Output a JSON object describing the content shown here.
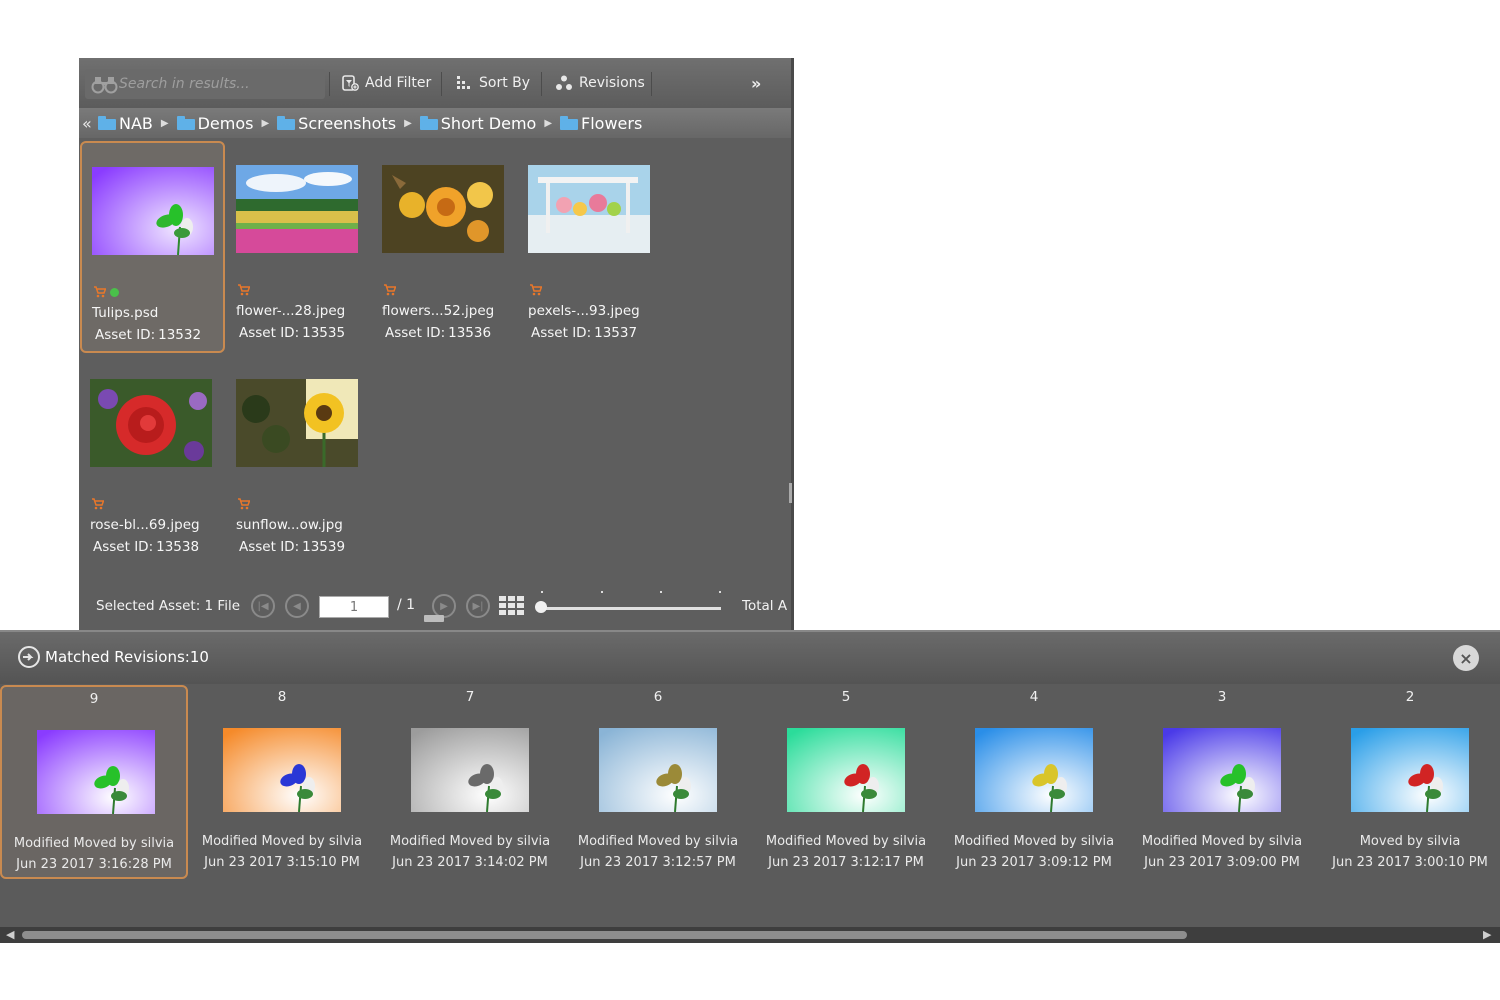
{
  "toolbar": {
    "search_placeholder": "Search in results...",
    "add_filter": "Add Filter",
    "sort_by": "Sort By",
    "revisions": "Revisions",
    "more": "»"
  },
  "breadcrumb": {
    "back": "«",
    "items": [
      "NAB",
      "Demos",
      "Screenshots",
      "Short Demo",
      "Flowers"
    ]
  },
  "assets": [
    {
      "name": "Tulips.psd",
      "id_label": "Asset ID:",
      "id": "13532",
      "selected": true
    },
    {
      "name": "flower-...28.jpeg",
      "id_label": "Asset ID:",
      "id": "13535"
    },
    {
      "name": "flowers...52.jpeg",
      "id_label": "Asset ID:",
      "id": "13536"
    },
    {
      "name": "pexels-...93.jpeg",
      "id_label": "Asset ID:",
      "id": "13537"
    },
    {
      "name": "rose-bl...69.jpeg",
      "id_label": "Asset ID:",
      "id": "13538"
    },
    {
      "name": "sunflow...ow.jpg",
      "id_label": "Asset ID:",
      "id": "13539"
    }
  ],
  "footer": {
    "selected_label": "Selected Asset: 1 File",
    "page_value": "1",
    "page_total": "/  1",
    "total_label": "Total A",
    "zoom_level": 0
  },
  "revisions_panel": {
    "title": "Matched Revisions:10",
    "close": "×",
    "items": [
      {
        "num": "9",
        "action": "Modified Moved by silvia",
        "date": "Jun 23 2017 3:16:28 PM",
        "bg": "#8a3cff",
        "flower": "#27c12a",
        "selected": true
      },
      {
        "num": "8",
        "action": "Modified Moved by silvia",
        "date": "Jun 23 2017 3:15:10 PM",
        "bg": "#f58a2a",
        "flower": "#2a37d6"
      },
      {
        "num": "7",
        "action": "Modified Moved by silvia",
        "date": "Jun 23 2017 3:14:02 PM",
        "bg": "#9c9c9c",
        "flower": "#6a6a6a"
      },
      {
        "num": "6",
        "action": "Modified Moved by silvia",
        "date": "Jun 23 2017 3:12:57 PM",
        "bg": "#8ab4d6",
        "flower": "#9b8a38"
      },
      {
        "num": "5",
        "action": "Modified Moved by silvia",
        "date": "Jun 23 2017 3:12:17 PM",
        "bg": "#2bdc9a",
        "flower": "#d12424"
      },
      {
        "num": "4",
        "action": "Modified Moved by silvia",
        "date": "Jun 23 2017 3:09:12 PM",
        "bg": "#2a8ee8",
        "flower": "#d9c52a"
      },
      {
        "num": "3",
        "action": "Modified Moved by silvia",
        "date": "Jun 23 2017 3:09:00 PM",
        "bg": "#4a3ae8",
        "flower": "#27c12a"
      },
      {
        "num": "2",
        "action": "Moved by silvia",
        "date": "Jun 23 2017 3:00:10 PM",
        "bg": "#2a9ee8",
        "flower": "#d12424"
      }
    ]
  },
  "colors": {
    "panel_bg": "#5e5e5e",
    "selection_border": "#c98a50",
    "folder": "#5fb1e8"
  }
}
